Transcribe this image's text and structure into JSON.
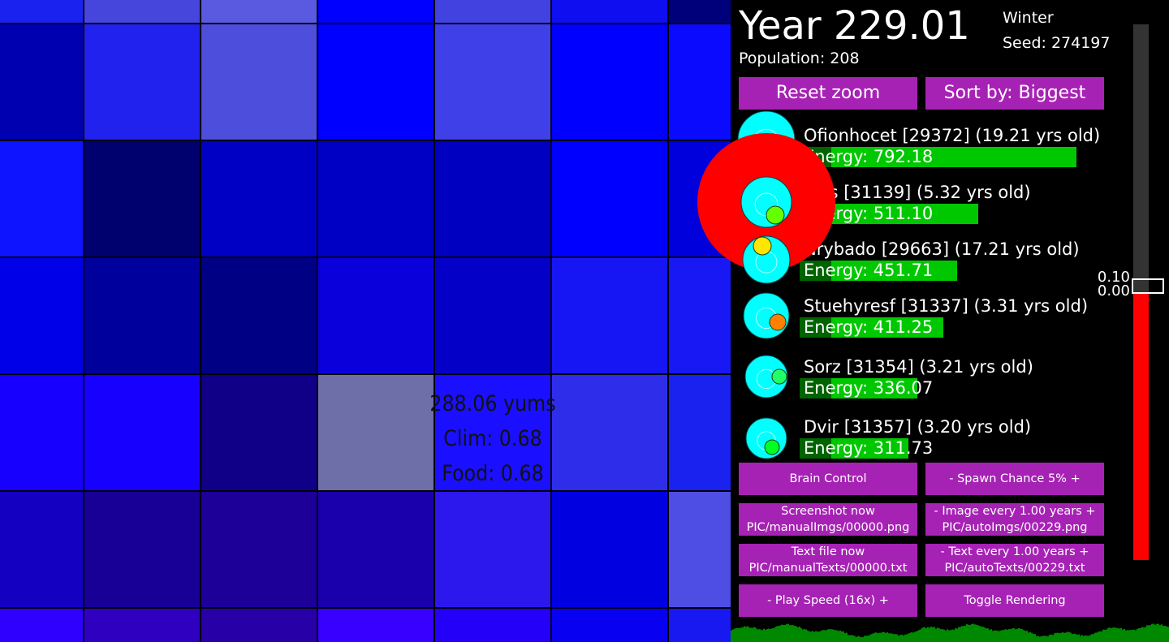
{
  "map": {
    "tile_colors": [
      [
        "#1a22f0",
        "#4646dc",
        "#5a5ae0",
        "#0000ff",
        "#4242e0",
        "#0e0ef0",
        "#00007a"
      ],
      [
        "#0000b0",
        "#2222ee",
        "#4e4edc",
        "#0000ff",
        "#4040e8",
        "#0000ff",
        "#0a0aff"
      ],
      [
        "#0e14ff",
        "#00006e",
        "#0000c4",
        "#0000c4",
        "#0000c0",
        "#0000ff",
        "#0000dc"
      ],
      [
        "#0000e8",
        "#00009c",
        "#000084",
        "#0a00dc",
        "#0500c8",
        "#1616f4",
        "#1818f4"
      ],
      [
        "#1800ff",
        "#1800ff",
        "#100088",
        "#6e6ea8",
        "#1a10ff",
        "#2e2eea",
        "#1a22f0"
      ],
      [
        "#1400c0",
        "#180096",
        "#1c0098",
        "#1a00ac",
        "#2c18ec",
        "#0000e0",
        "#4e4ee4"
      ],
      [
        "#3000ff",
        "#3000c0",
        "#2800a8",
        "#3800ff",
        "#2400f8",
        "#0800f0",
        "#1818f0"
      ]
    ],
    "tile_info": {
      "energy": "288.06 yums",
      "clim": "Clim: 0.68",
      "food": "Food: 0.68"
    }
  },
  "header": {
    "year": "Year 229.01",
    "population": "Population: 208",
    "season": "Winter",
    "seed": "Seed: 274197"
  },
  "buttons": {
    "reset_zoom": "Reset zoom",
    "sort_by": "Sort by: Biggest",
    "brain_control": "Brain Control",
    "spawn_chance": "-   Spawn Chance 5%   +",
    "screenshot_now": "Screenshot now",
    "screenshot_path": "PIC/manualImgs/00000.png",
    "image_every": "-   Image every 1.00 years   +",
    "image_path": "PIC/autoImgs/00229.png",
    "text_file_now": "Text file now",
    "text_file_path": "PIC/manualTexts/00000.txt",
    "text_every": "-   Text every 1.00 years   +",
    "text_path": "PIC/autoTexts/00229.txt",
    "play_speed": "-   Play Speed (16x)   +",
    "toggle_rendering": "Toggle Rendering"
  },
  "creatures": [
    {
      "name": "Ofionhocet [29372] (19.21 yrs old)",
      "energy_label": "Energy: 792.18",
      "energy": 792.18,
      "mouth_color": "#00ffff"
    },
    {
      "name": "Fros [31139] (5.32 yrs old)",
      "energy_label": "Energy: 511.10",
      "energy": 511.1,
      "mouth_color": "#66ff00"
    },
    {
      "name": "Nrybado [29663] (17.21 yrs old)",
      "energy_label": "Energy: 451.71",
      "energy": 451.71,
      "mouth_color": "#ffe600"
    },
    {
      "name": "Stuehyresf [31337] (3.31 yrs old)",
      "energy_label": "Energy: 411.25",
      "energy": 411.25,
      "mouth_color": "#ff8000"
    },
    {
      "name": "Sorz [31354] (3.21 yrs old)",
      "energy_label": "Energy: 336.07",
      "energy": 336.07,
      "mouth_color": "#22ff66"
    },
    {
      "name": "Dvir [31357] (3.20 yrs old)",
      "energy_label": "Energy: 311.73",
      "energy": 311.73,
      "mouth_color": "#00ff22"
    }
  ],
  "slider": {
    "label_top": "0.10",
    "label_bottom": "0.00",
    "level": 0.5,
    "fill_color": "#ff0000"
  },
  "colors": {
    "button": "#a622b4",
    "energy_bar": "#00c800",
    "energy_dark": "#006400",
    "selected_creature": "#ff0000",
    "creature_body": "#00ffff"
  }
}
